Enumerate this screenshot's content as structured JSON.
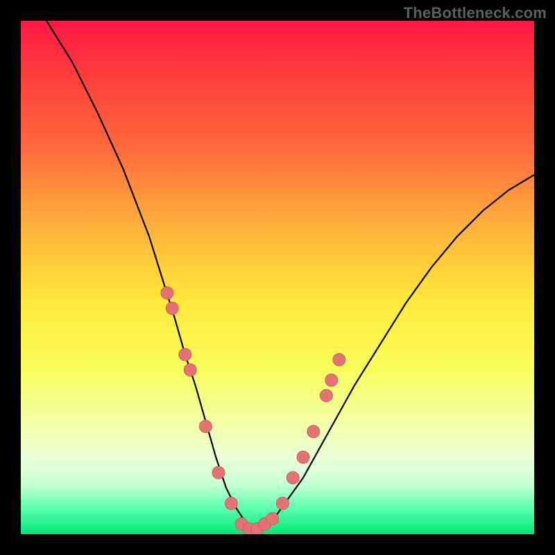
{
  "watermark": "TheBottleneck.com",
  "colors": {
    "background": "#000000",
    "gradient_top": "#ff1744",
    "gradient_mid": "#ffe93b",
    "gradient_bottom": "#00e676",
    "curve": "#000000",
    "marker_fill": "#e57373",
    "marker_stroke": "#c96161"
  },
  "chart_data": {
    "type": "line",
    "title": "",
    "xlabel": "",
    "ylabel": "",
    "xlim": [
      0,
      100
    ],
    "ylim": [
      0,
      100
    ],
    "grid": false,
    "legend": false,
    "series": [
      {
        "name": "curve",
        "x": [
          5,
          10,
          15,
          20,
          25,
          30,
          32,
          34,
          36,
          38,
          40,
          42,
          44,
          46,
          48,
          50,
          55,
          60,
          65,
          70,
          75,
          80,
          85,
          90,
          95,
          100
        ],
        "y": [
          100,
          92,
          82,
          71,
          58,
          42,
          35,
          29,
          22,
          15,
          9,
          5,
          2,
          1,
          2,
          4,
          11,
          20,
          29,
          37,
          45,
          52,
          58,
          63,
          67,
          70
        ]
      }
    ],
    "markers": [
      {
        "x": 28.5,
        "y": 47
      },
      {
        "x": 29.5,
        "y": 44
      },
      {
        "x": 32.0,
        "y": 35
      },
      {
        "x": 33.0,
        "y": 32
      },
      {
        "x": 36.0,
        "y": 21
      },
      {
        "x": 38.5,
        "y": 12
      },
      {
        "x": 41.0,
        "y": 6
      },
      {
        "x": 43.0,
        "y": 2
      },
      {
        "x": 44.5,
        "y": 1
      },
      {
        "x": 46.0,
        "y": 1
      },
      {
        "x": 47.5,
        "y": 2
      },
      {
        "x": 49.0,
        "y": 3
      },
      {
        "x": 51.0,
        "y": 6
      },
      {
        "x": 53.0,
        "y": 11
      },
      {
        "x": 55.0,
        "y": 15
      },
      {
        "x": 57.0,
        "y": 20
      },
      {
        "x": 59.5,
        "y": 27
      },
      {
        "x": 60.5,
        "y": 30
      },
      {
        "x": 62.0,
        "y": 34
      }
    ]
  }
}
